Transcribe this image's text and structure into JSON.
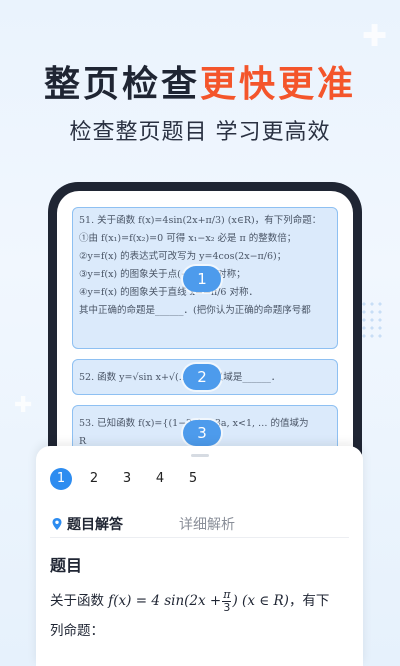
{
  "hero": {
    "title_dark": "整页检查",
    "title_accent": "更快更准",
    "subtitle": "检查整页题目 学习更高效"
  },
  "colors": {
    "accent": "#f4552b",
    "primary": "#2d8cf0",
    "card_bg": "#dbeafb",
    "card_border": "#8ec0f2"
  },
  "questions": [
    {
      "badge": "1",
      "lines": [
        "51. 关于函数 f(x)=4sin(2x+π/3) (x∈R)，有下列命题：",
        "①由 f(x₁)=f(x₂)=0 可得 x₁−x₂ 必是 π 的整数倍；",
        "②y=f(x) 的表达式可改写为 y=4cos(2x−π/6)；",
        "③y=f(x) 的图象关于点(−π/6,0)对称；",
        "④y=f(x) 的图象关于直线 x=−π/6 对称．",
        "其中正确的命题是______．(把你认为正确的命题序号都"
      ]
    },
    {
      "badge": "2",
      "lines": [
        "52. 函数 y=√sin x+√(…) 的定义域是______．"
      ]
    },
    {
      "badge": "3",
      "lines": [
        "53. 已知函数 f(x)={(1−2a)x+3a, x<1, … 的值域为",
        "R"
      ]
    }
  ],
  "sheet": {
    "numbers": [
      "1",
      "2",
      "3",
      "4",
      "5"
    ],
    "active_number": "1",
    "tab_answer": "题目解答",
    "tab_detail": "详细解析",
    "content_title": "题目",
    "content_prefix": "关于函数",
    "content_formula": "f(x) = 4 sin",
    "content_formula_inner_a": "(2x +",
    "frac_num": "π",
    "frac_den": "3",
    "content_formula_inner_b": ")",
    "content_domain": "(x ∈ R)",
    "content_suffix": "，有下",
    "content_line2": "列命题："
  }
}
